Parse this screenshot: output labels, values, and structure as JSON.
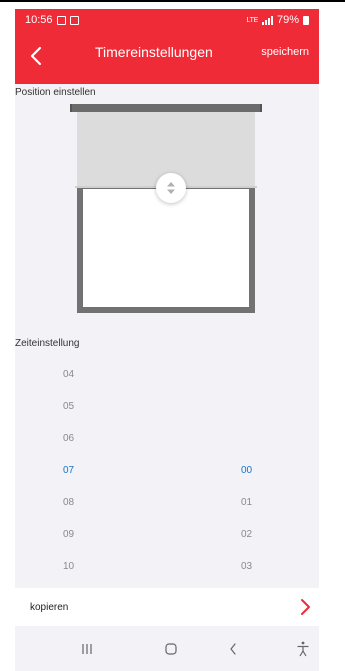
{
  "status_bar": {
    "time": "10:56",
    "signal_text": "LTE",
    "battery": "79%"
  },
  "header": {
    "title": "Timereinstellungen",
    "save_label": "speichern"
  },
  "position": {
    "label": "Position einstellen",
    "shutter_closed_fraction": 0.38
  },
  "time_setting": {
    "label": "Zeiteinstellung",
    "hours": [
      "04",
      "05",
      "06",
      "07",
      "08",
      "09",
      "10"
    ],
    "minutes": [
      "00",
      "01",
      "02",
      "03"
    ],
    "selected_hour": "07",
    "selected_minute": "00"
  },
  "copy": {
    "label": "kopieren"
  },
  "colors": {
    "accent": "#ee2b37",
    "selected": "#1a73c9"
  },
  "icons": {
    "back": "chevron-left-icon",
    "copy": "chevron-right-icon"
  }
}
